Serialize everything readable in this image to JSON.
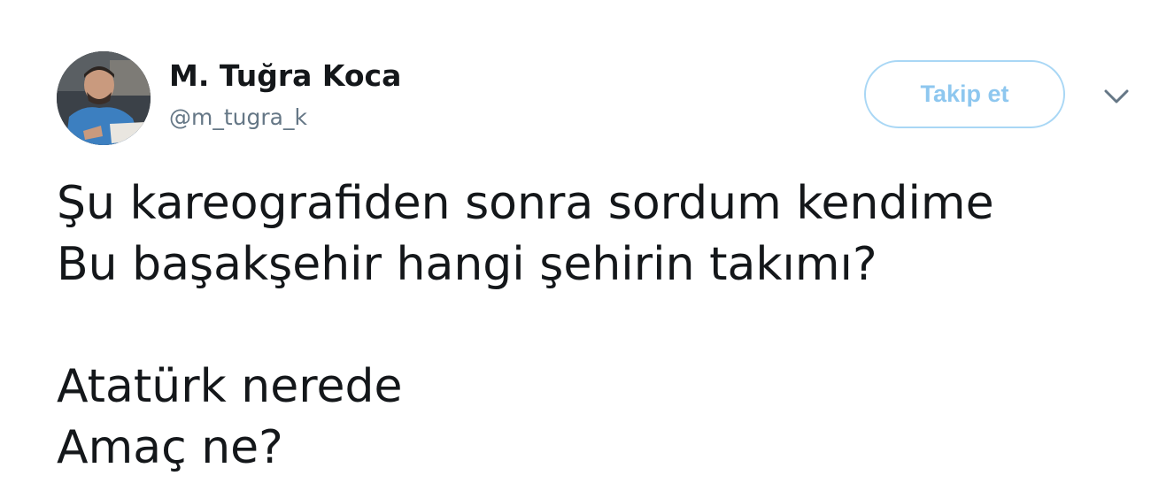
{
  "author": {
    "name": "M. Tuğra Koca",
    "handle": "@m_tugra_k",
    "avatar_icon": "user-avatar"
  },
  "actions": {
    "follow_label": "Takip et",
    "more_icon": "chevron-down-icon"
  },
  "tweet": {
    "lines": [
      "Şu kareografiden sonra sordum kendime",
      "Bu başakşehir hangi şehirin takımı?",
      "",
      "Atatürk nerede",
      "Amaç ne?"
    ]
  },
  "colors": {
    "text": "#14171a",
    "secondary_text": "#657786",
    "follow_border": "#a9d7f5",
    "follow_text": "#8ec7ef"
  }
}
